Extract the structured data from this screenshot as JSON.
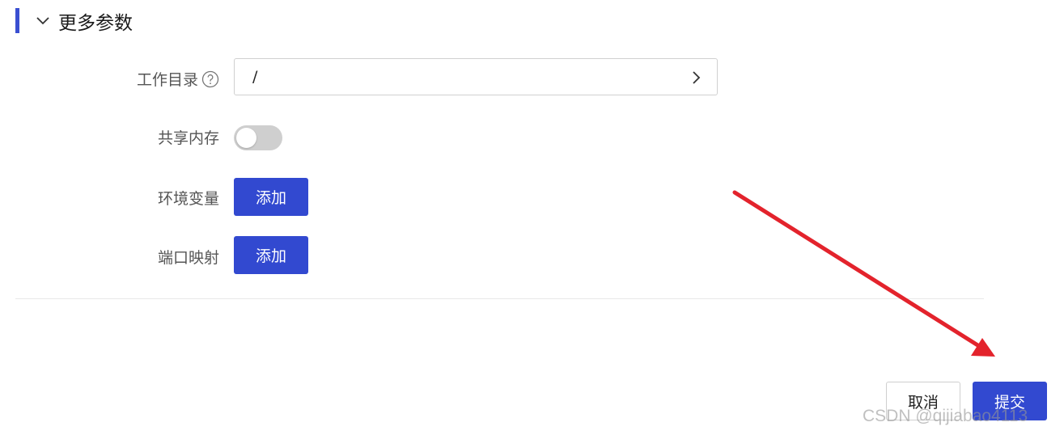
{
  "section": {
    "title": "更多参数",
    "expanded": true,
    "accent_color": "#3a4fd1"
  },
  "working_dir": {
    "label": "工作目录",
    "value": "/",
    "help_icon": "question-circle-icon",
    "arrow_icon": "chevron-right-icon"
  },
  "shared_memory": {
    "label": "共享内存",
    "enabled": false
  },
  "env_vars": {
    "label": "环境变量",
    "add_label": "添加"
  },
  "port_mapping": {
    "label": "端口映射",
    "add_label": "添加"
  },
  "footer": {
    "cancel_label": "取消",
    "submit_label": "提交"
  },
  "annotation": {
    "arrow_color": "#e3232c"
  },
  "watermark": "CSDN @qijiabao4113",
  "colors": {
    "primary": "#3249d0",
    "toggle_off": "#cfcfcf"
  }
}
